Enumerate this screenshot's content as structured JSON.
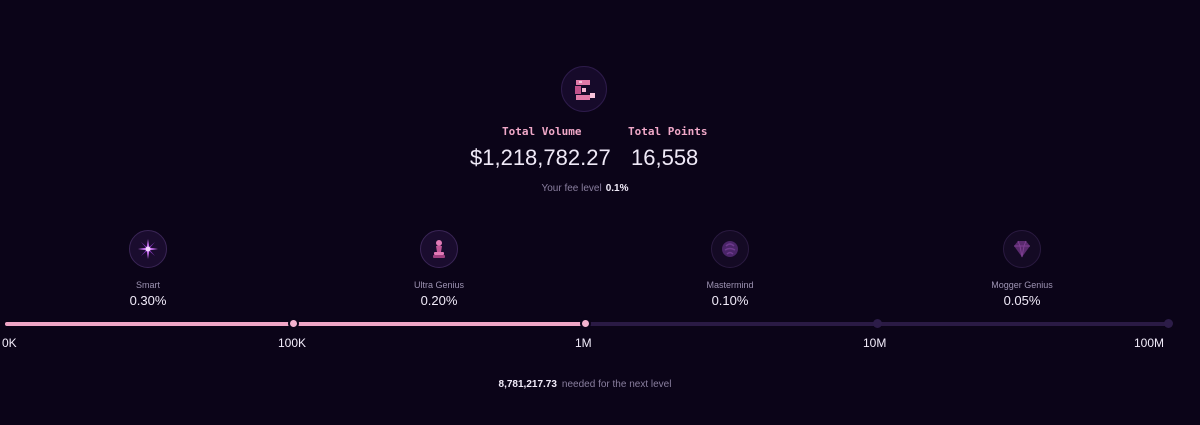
{
  "logo": {
    "icon": "brand-logo-icon",
    "color": "#f0a6c6"
  },
  "stats": {
    "total_volume_label": "Total Volume",
    "total_volume_value": "$1,218,782.27",
    "total_points_label": "Total Points",
    "total_points_value": "16,558"
  },
  "fee": {
    "label": "Your fee level",
    "value": "0.1%"
  },
  "tiers": [
    {
      "name": "Smart",
      "fee": "0.30%",
      "icon": "sparkle-icon"
    },
    {
      "name": "Ultra Genius",
      "fee": "0.20%",
      "icon": "chess-piece-icon"
    },
    {
      "name": "Mastermind",
      "fee": "0.10%",
      "icon": "brain-icon"
    },
    {
      "name": "Mogger Genius",
      "fee": "0.05%",
      "icon": "diamond-icon"
    }
  ],
  "progress": {
    "ticks": [
      "0K",
      "100K",
      "1M",
      "10M",
      "100M"
    ],
    "fraction": 0.5,
    "fill_color": "#f0a6c6",
    "track_color": "#2a1a44"
  },
  "next_level": {
    "value": "8,781,217.73",
    "label": "needed for the next level"
  }
}
